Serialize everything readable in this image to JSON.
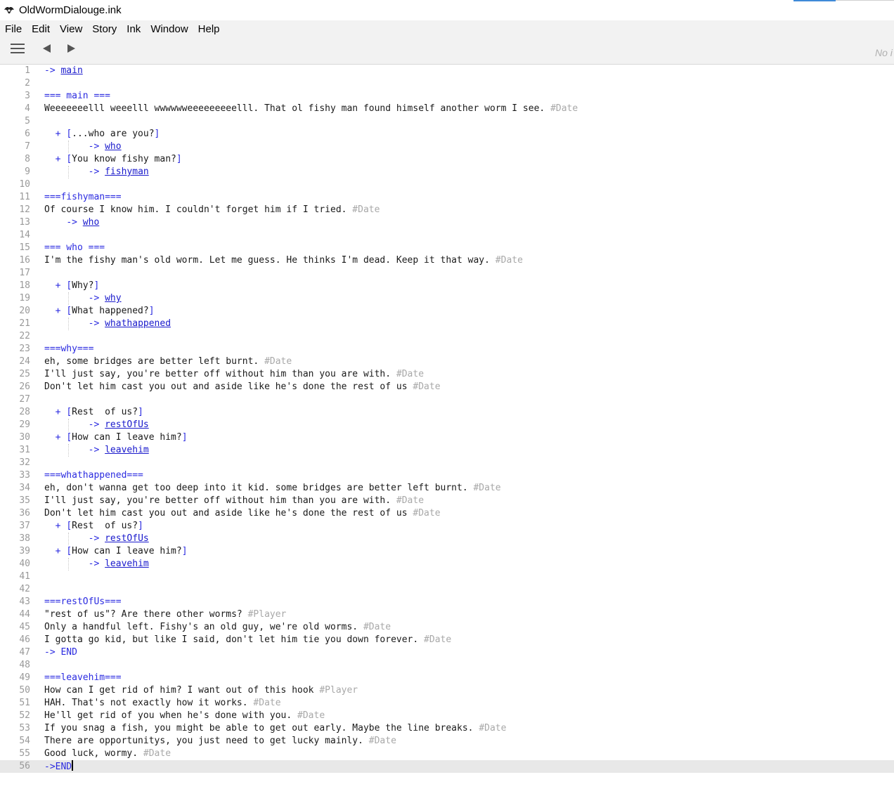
{
  "window": {
    "title": "OldWormDialouge.ink"
  },
  "menu": [
    "File",
    "Edit",
    "View",
    "Story",
    "Ink",
    "Window",
    "Help"
  ],
  "toolbar": {
    "status_text": "No i"
  },
  "colors": {
    "knot": "#2b2be0",
    "divert_target": "#1a1acc",
    "tag": "#a8a8a8",
    "text": "#1a1a1a",
    "line_number": "#999999",
    "current_line": "#e8e8e8"
  },
  "editor": {
    "current_line": 56,
    "lines": [
      [
        [
          "d",
          "-> "
        ],
        [
          "t",
          "main"
        ]
      ],
      [],
      [
        [
          "k",
          "=== main ==="
        ]
      ],
      [
        [
          "x",
          "Weeeeeeelll weeelll wwwwwweeeeeeeeelll. That ol fishy man found himself another worm I see. "
        ],
        [
          "g",
          "#Date"
        ]
      ],
      [],
      [
        [
          "x",
          "  "
        ],
        [
          "c",
          "+ "
        ],
        [
          "b",
          "["
        ],
        [
          "x",
          "...who are you?"
        ],
        [
          "b",
          "]"
        ]
      ],
      [
        [
          "x",
          "        "
        ],
        [
          "d",
          "-> "
        ],
        [
          "t",
          "who"
        ]
      ],
      [
        [
          "x",
          "  "
        ],
        [
          "c",
          "+ "
        ],
        [
          "b",
          "["
        ],
        [
          "x",
          "You know fishy man?"
        ],
        [
          "b",
          "]"
        ]
      ],
      [
        [
          "x",
          "        "
        ],
        [
          "d",
          "-> "
        ],
        [
          "t",
          "fishyman"
        ]
      ],
      [],
      [
        [
          "k",
          "===fishyman==="
        ]
      ],
      [
        [
          "x",
          "Of course I know him. I couldn't forget him if I tried. "
        ],
        [
          "g",
          "#Date"
        ]
      ],
      [
        [
          "x",
          "    "
        ],
        [
          "d",
          "-> "
        ],
        [
          "t",
          "who"
        ]
      ],
      [],
      [
        [
          "k",
          "=== who ==="
        ]
      ],
      [
        [
          "x",
          "I'm the fishy man's old worm. Let me guess. He thinks I'm dead. Keep it that way. "
        ],
        [
          "g",
          "#Date"
        ]
      ],
      [],
      [
        [
          "x",
          "  "
        ],
        [
          "c",
          "+ "
        ],
        [
          "b",
          "["
        ],
        [
          "x",
          "Why?"
        ],
        [
          "b",
          "]"
        ]
      ],
      [
        [
          "x",
          "        "
        ],
        [
          "d",
          "-> "
        ],
        [
          "t",
          "why"
        ]
      ],
      [
        [
          "x",
          "  "
        ],
        [
          "c",
          "+ "
        ],
        [
          "b",
          "["
        ],
        [
          "x",
          "What happened?"
        ],
        [
          "b",
          "]"
        ]
      ],
      [
        [
          "x",
          "        "
        ],
        [
          "d",
          "-> "
        ],
        [
          "t",
          "whathappened"
        ]
      ],
      [],
      [
        [
          "k",
          "===why==="
        ]
      ],
      [
        [
          "x",
          "eh, some bridges are better left burnt. "
        ],
        [
          "g",
          "#Date"
        ]
      ],
      [
        [
          "x",
          "I'll just say, you're better off without him than you are with. "
        ],
        [
          "g",
          "#Date"
        ]
      ],
      [
        [
          "x",
          "Don't let him cast you out and aside like he's done the rest of us "
        ],
        [
          "g",
          "#Date"
        ]
      ],
      [],
      [
        [
          "x",
          "  "
        ],
        [
          "c",
          "+ "
        ],
        [
          "b",
          "["
        ],
        [
          "x",
          "Rest  of us?"
        ],
        [
          "b",
          "]"
        ]
      ],
      [
        [
          "x",
          "        "
        ],
        [
          "d",
          "-> "
        ],
        [
          "t",
          "restOfUs"
        ]
      ],
      [
        [
          "x",
          "  "
        ],
        [
          "c",
          "+ "
        ],
        [
          "b",
          "["
        ],
        [
          "x",
          "How can I leave him?"
        ],
        [
          "b",
          "]"
        ]
      ],
      [
        [
          "x",
          "        "
        ],
        [
          "d",
          "-> "
        ],
        [
          "t",
          "leavehim"
        ]
      ],
      [],
      [
        [
          "k",
          "===whathappened==="
        ]
      ],
      [
        [
          "x",
          "eh, don't wanna get too deep into it kid. some bridges are better left burnt. "
        ],
        [
          "g",
          "#Date"
        ]
      ],
      [
        [
          "x",
          "I'll just say, you're better off without him than you are with. "
        ],
        [
          "g",
          "#Date"
        ]
      ],
      [
        [
          "x",
          "Don't let him cast you out and aside like he's done the rest of us "
        ],
        [
          "g",
          "#Date"
        ]
      ],
      [
        [
          "x",
          "  "
        ],
        [
          "c",
          "+ "
        ],
        [
          "b",
          "["
        ],
        [
          "x",
          "Rest  of us?"
        ],
        [
          "b",
          "]"
        ]
      ],
      [
        [
          "x",
          "        "
        ],
        [
          "d",
          "-> "
        ],
        [
          "t",
          "restOfUs"
        ]
      ],
      [
        [
          "x",
          "  "
        ],
        [
          "c",
          "+ "
        ],
        [
          "b",
          "["
        ],
        [
          "x",
          "How can I leave him?"
        ],
        [
          "b",
          "]"
        ]
      ],
      [
        [
          "x",
          "        "
        ],
        [
          "d",
          "-> "
        ],
        [
          "t",
          "leavehim"
        ]
      ],
      [],
      [],
      [
        [
          "k",
          "===restOfUs==="
        ]
      ],
      [
        [
          "x",
          "\"rest of us\"? Are there other worms? "
        ],
        [
          "g",
          "#Player"
        ]
      ],
      [
        [
          "x",
          "Only a handful left. Fishy's an old guy, we're old worms. "
        ],
        [
          "g",
          "#Date"
        ]
      ],
      [
        [
          "x",
          "I gotta go kid, but like I said, don't let him tie you down forever. "
        ],
        [
          "g",
          "#Date"
        ]
      ],
      [
        [
          "d",
          "-> END"
        ]
      ],
      [],
      [
        [
          "k",
          "===leavehim==="
        ]
      ],
      [
        [
          "x",
          "How can I get rid of him? I want out of this hook "
        ],
        [
          "g",
          "#Player"
        ]
      ],
      [
        [
          "x",
          "HAH. That's not exactly how it works. "
        ],
        [
          "g",
          "#Date"
        ]
      ],
      [
        [
          "x",
          "He'll get rid of you when he's done with you. "
        ],
        [
          "g",
          "#Date"
        ]
      ],
      [
        [
          "x",
          "If you snag a fish, you might be able to get out early. Maybe the line breaks. "
        ],
        [
          "g",
          "#Date"
        ]
      ],
      [
        [
          "x",
          "There are opportunitys, you just need to get lucky mainly. "
        ],
        [
          "g",
          "#Date"
        ]
      ],
      [
        [
          "x",
          "Good luck, wormy. "
        ],
        [
          "g",
          "#Date"
        ]
      ],
      [
        [
          "d",
          "->END"
        ]
      ]
    ]
  }
}
